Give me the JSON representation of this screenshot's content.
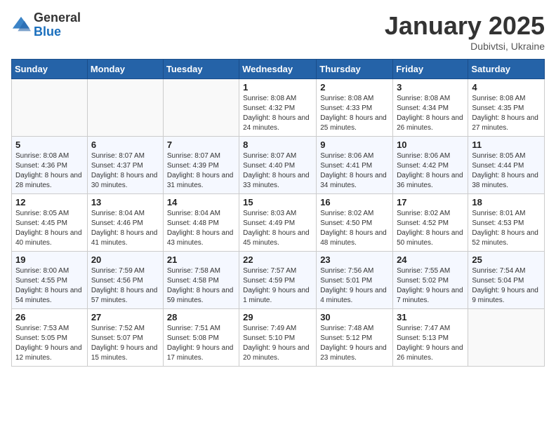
{
  "header": {
    "logo_general": "General",
    "logo_blue": "Blue",
    "month_title": "January 2025",
    "subtitle": "Dubivtsi, Ukraine"
  },
  "weekdays": [
    "Sunday",
    "Monday",
    "Tuesday",
    "Wednesday",
    "Thursday",
    "Friday",
    "Saturday"
  ],
  "weeks": [
    [
      {
        "day": "",
        "info": ""
      },
      {
        "day": "",
        "info": ""
      },
      {
        "day": "",
        "info": ""
      },
      {
        "day": "1",
        "info": "Sunrise: 8:08 AM\nSunset: 4:32 PM\nDaylight: 8 hours\nand 24 minutes."
      },
      {
        "day": "2",
        "info": "Sunrise: 8:08 AM\nSunset: 4:33 PM\nDaylight: 8 hours\nand 25 minutes."
      },
      {
        "day": "3",
        "info": "Sunrise: 8:08 AM\nSunset: 4:34 PM\nDaylight: 8 hours\nand 26 minutes."
      },
      {
        "day": "4",
        "info": "Sunrise: 8:08 AM\nSunset: 4:35 PM\nDaylight: 8 hours\nand 27 minutes."
      }
    ],
    [
      {
        "day": "5",
        "info": "Sunrise: 8:08 AM\nSunset: 4:36 PM\nDaylight: 8 hours\nand 28 minutes."
      },
      {
        "day": "6",
        "info": "Sunrise: 8:07 AM\nSunset: 4:37 PM\nDaylight: 8 hours\nand 30 minutes."
      },
      {
        "day": "7",
        "info": "Sunrise: 8:07 AM\nSunset: 4:39 PM\nDaylight: 8 hours\nand 31 minutes."
      },
      {
        "day": "8",
        "info": "Sunrise: 8:07 AM\nSunset: 4:40 PM\nDaylight: 8 hours\nand 33 minutes."
      },
      {
        "day": "9",
        "info": "Sunrise: 8:06 AM\nSunset: 4:41 PM\nDaylight: 8 hours\nand 34 minutes."
      },
      {
        "day": "10",
        "info": "Sunrise: 8:06 AM\nSunset: 4:42 PM\nDaylight: 8 hours\nand 36 minutes."
      },
      {
        "day": "11",
        "info": "Sunrise: 8:05 AM\nSunset: 4:44 PM\nDaylight: 8 hours\nand 38 minutes."
      }
    ],
    [
      {
        "day": "12",
        "info": "Sunrise: 8:05 AM\nSunset: 4:45 PM\nDaylight: 8 hours\nand 40 minutes."
      },
      {
        "day": "13",
        "info": "Sunrise: 8:04 AM\nSunset: 4:46 PM\nDaylight: 8 hours\nand 41 minutes."
      },
      {
        "day": "14",
        "info": "Sunrise: 8:04 AM\nSunset: 4:48 PM\nDaylight: 8 hours\nand 43 minutes."
      },
      {
        "day": "15",
        "info": "Sunrise: 8:03 AM\nSunset: 4:49 PM\nDaylight: 8 hours\nand 45 minutes."
      },
      {
        "day": "16",
        "info": "Sunrise: 8:02 AM\nSunset: 4:50 PM\nDaylight: 8 hours\nand 48 minutes."
      },
      {
        "day": "17",
        "info": "Sunrise: 8:02 AM\nSunset: 4:52 PM\nDaylight: 8 hours\nand 50 minutes."
      },
      {
        "day": "18",
        "info": "Sunrise: 8:01 AM\nSunset: 4:53 PM\nDaylight: 8 hours\nand 52 minutes."
      }
    ],
    [
      {
        "day": "19",
        "info": "Sunrise: 8:00 AM\nSunset: 4:55 PM\nDaylight: 8 hours\nand 54 minutes."
      },
      {
        "day": "20",
        "info": "Sunrise: 7:59 AM\nSunset: 4:56 PM\nDaylight: 8 hours\nand 57 minutes."
      },
      {
        "day": "21",
        "info": "Sunrise: 7:58 AM\nSunset: 4:58 PM\nDaylight: 8 hours\nand 59 minutes."
      },
      {
        "day": "22",
        "info": "Sunrise: 7:57 AM\nSunset: 4:59 PM\nDaylight: 9 hours\nand 1 minute."
      },
      {
        "day": "23",
        "info": "Sunrise: 7:56 AM\nSunset: 5:01 PM\nDaylight: 9 hours\nand 4 minutes."
      },
      {
        "day": "24",
        "info": "Sunrise: 7:55 AM\nSunset: 5:02 PM\nDaylight: 9 hours\nand 7 minutes."
      },
      {
        "day": "25",
        "info": "Sunrise: 7:54 AM\nSunset: 5:04 PM\nDaylight: 9 hours\nand 9 minutes."
      }
    ],
    [
      {
        "day": "26",
        "info": "Sunrise: 7:53 AM\nSunset: 5:05 PM\nDaylight: 9 hours\nand 12 minutes."
      },
      {
        "day": "27",
        "info": "Sunrise: 7:52 AM\nSunset: 5:07 PM\nDaylight: 9 hours\nand 15 minutes."
      },
      {
        "day": "28",
        "info": "Sunrise: 7:51 AM\nSunset: 5:08 PM\nDaylight: 9 hours\nand 17 minutes."
      },
      {
        "day": "29",
        "info": "Sunrise: 7:49 AM\nSunset: 5:10 PM\nDaylight: 9 hours\nand 20 minutes."
      },
      {
        "day": "30",
        "info": "Sunrise: 7:48 AM\nSunset: 5:12 PM\nDaylight: 9 hours\nand 23 minutes."
      },
      {
        "day": "31",
        "info": "Sunrise: 7:47 AM\nSunset: 5:13 PM\nDaylight: 9 hours\nand 26 minutes."
      },
      {
        "day": "",
        "info": ""
      }
    ]
  ]
}
